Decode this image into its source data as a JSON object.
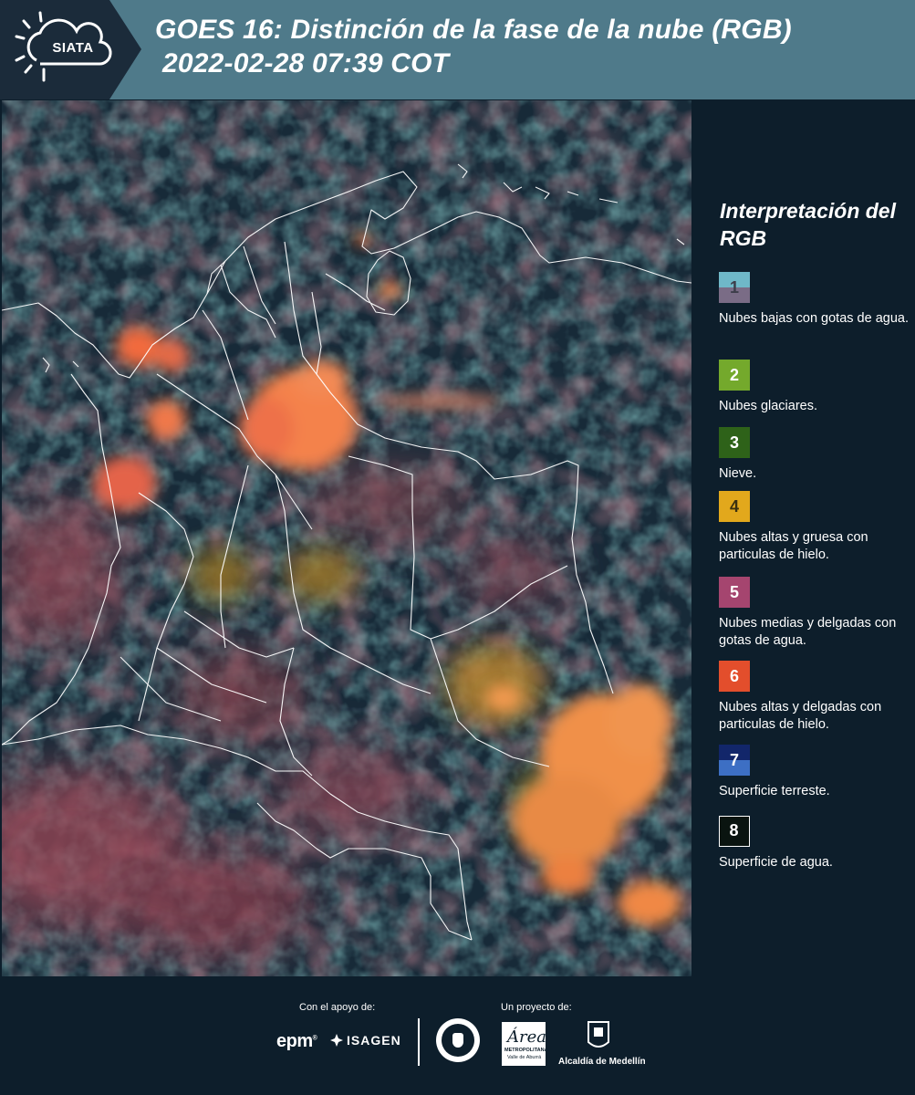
{
  "header": {
    "logo_text": "SIATA",
    "title_line1": "GOES 16: Distinción de la fase de la nube (RGB)",
    "title_line2": "2022-02-28 07:39 COT"
  },
  "legend": {
    "title": "Interpretación del RGB",
    "items": [
      {
        "number": "1",
        "label": "Nubes bajas con gotas de agua.",
        "colors": [
          "#6fb8c8",
          "#7a6c86"
        ],
        "num_color": "#3d3d4a"
      },
      {
        "number": "2",
        "label": "Nubes glaciares.",
        "colors": [
          "#74a92c"
        ],
        "num_color": "#ffffff"
      },
      {
        "number": "3",
        "label": "Nieve.",
        "colors": [
          "#2e6219"
        ],
        "num_color": "#ffffff"
      },
      {
        "number": "4",
        "label": "Nubes altas y gruesa con particulas de hielo.",
        "colors": [
          "#e2a81c"
        ],
        "num_color": "#3a3010"
      },
      {
        "number": "5",
        "label": "Nubes medias y delgadas con gotas de agua.",
        "colors": [
          "#a5456f"
        ],
        "num_color": "#ffffff"
      },
      {
        "number": "6",
        "label": "Nubes altas y delgadas con particulas de hielo.",
        "colors": [
          "#e34e2c"
        ],
        "num_color": "#ffffff"
      },
      {
        "number": "7",
        "label": "Superficie terreste.",
        "colors": [
          "#12266a",
          "#3d6fc4"
        ],
        "num_color": "#ffffff"
      },
      {
        "number": "8",
        "label": "Superficie de agua.",
        "colors": [
          "#0a1410"
        ],
        "num_color": "#ffffff"
      }
    ]
  },
  "footer": {
    "support_label": "Con el apoyo de:",
    "project_label": "Un proyecto de:",
    "epm": "epm",
    "isagen": "ISAGEN",
    "area_script": "Área",
    "area_small1": "METROPOLITANA",
    "area_small2": "Valle de Aburrá",
    "medellin": "Alcaldía de Medellín"
  }
}
